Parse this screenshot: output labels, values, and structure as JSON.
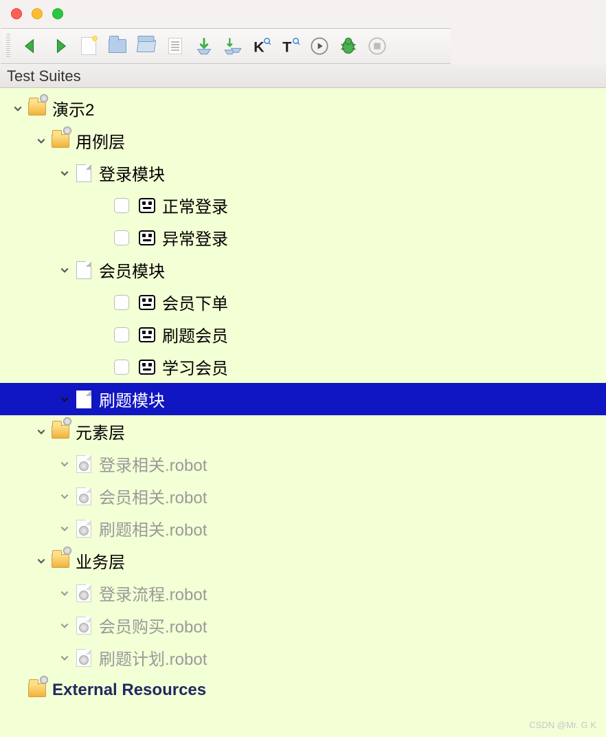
{
  "panel_title": "Test Suites",
  "toolbar": {
    "items": [
      "back",
      "forward",
      "new-file",
      "open-folder-1",
      "open-folder-2",
      "document",
      "save",
      "save-all",
      "keyword",
      "text-search",
      "run",
      "debug",
      "stop"
    ]
  },
  "tree": {
    "root": {
      "label": "演示2",
      "type": "project-folder",
      "expanded": true,
      "children": [
        {
          "label": "用例层",
          "type": "folder",
          "expanded": true,
          "children": [
            {
              "label": "登录模块",
              "type": "suite-file",
              "expanded": true,
              "children": [
                {
                  "label": "正常登录",
                  "type": "testcase"
                },
                {
                  "label": "异常登录",
                  "type": "testcase"
                }
              ]
            },
            {
              "label": "会员模块",
              "type": "suite-file",
              "expanded": true,
              "children": [
                {
                  "label": "会员下单",
                  "type": "testcase"
                },
                {
                  "label": "刷题会员",
                  "type": "testcase"
                },
                {
                  "label": "学习会员",
                  "type": "testcase"
                }
              ]
            },
            {
              "label": "刷题模块",
              "type": "suite-file",
              "expanded": true,
              "selected": true,
              "children": []
            }
          ]
        },
        {
          "label": "元素层",
          "type": "folder",
          "expanded": true,
          "children": [
            {
              "label": "登录相关.robot",
              "type": "resource",
              "expanded": true
            },
            {
              "label": "会员相关.robot",
              "type": "resource",
              "expanded": true
            },
            {
              "label": "刷题相关.robot",
              "type": "resource",
              "expanded": true
            }
          ]
        },
        {
          "label": "业务层",
          "type": "folder",
          "expanded": true,
          "children": [
            {
              "label": "登录流程.robot",
              "type": "resource",
              "expanded": true
            },
            {
              "label": "会员购买.robot",
              "type": "resource",
              "expanded": true
            },
            {
              "label": "刷题计划.robot",
              "type": "resource",
              "expanded": true
            }
          ]
        }
      ]
    },
    "external": {
      "label": "External Resources"
    }
  },
  "watermark": "CSDN @Mr. G K"
}
